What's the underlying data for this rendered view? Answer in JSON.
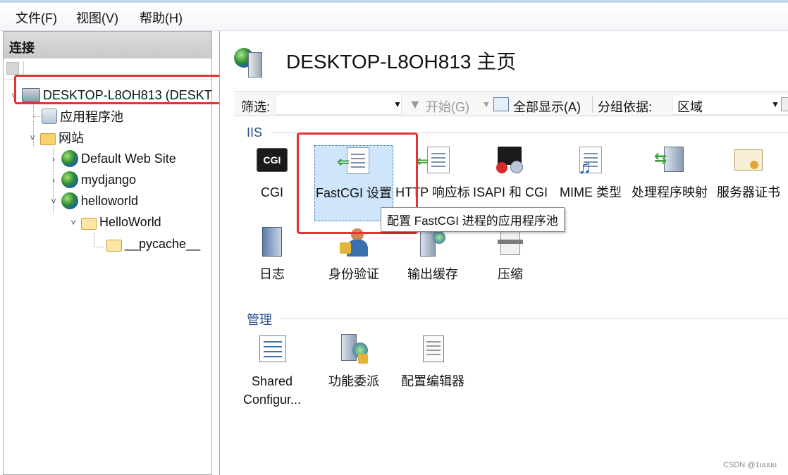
{
  "menu": [
    "文件(F)",
    "视图(V)",
    "帮助(H)"
  ],
  "connections": {
    "header": "连接",
    "tree": [
      {
        "label": "DESKTOP-L8OH813 (DESKT",
        "level": 0
      },
      {
        "label": "应用程序池",
        "level": 1
      },
      {
        "label": "网站",
        "level": 1
      },
      {
        "label": "Default Web Site",
        "level": 2
      },
      {
        "label": "mydjango",
        "level": 2
      },
      {
        "label": "helloworld",
        "level": 2
      },
      {
        "label": "HelloWorld",
        "level": 3
      },
      {
        "label": "__pycache__",
        "level": 4
      }
    ]
  },
  "main": {
    "title": "DESKTOP-L8OH813 主页",
    "filter": {
      "label": "筛选:",
      "value": "",
      "start_label": "开始(G)",
      "show_all_label": "全部显示(A)",
      "group_by_label": "分组依据:",
      "group_by_value": "区域"
    },
    "groups": [
      {
        "name": "IIS",
        "features": [
          {
            "label": "CGI",
            "icon": "cgi-icon"
          },
          {
            "label": "FastCGI 设置",
            "icon": "fastcgi-icon"
          },
          {
            "label": "HTTP 响应标",
            "icon": "http-response-headers-icon"
          },
          {
            "label": "ISAPI 和 CGI",
            "icon": "isapi-cgi-restrictions-icon"
          },
          {
            "label": "MIME 类型",
            "icon": "mime-types-icon"
          },
          {
            "label": "处理程序映射",
            "icon": "handler-mappings-icon"
          },
          {
            "label": "服务器证书",
            "icon": "server-certificates-icon"
          },
          {
            "label": "日志",
            "icon": "logging-icon"
          },
          {
            "label": "身份验证",
            "icon": "authentication-icon"
          },
          {
            "label": "输出缓存",
            "icon": "output-caching-icon"
          },
          {
            "label": "压缩",
            "icon": "compression-icon"
          }
        ]
      },
      {
        "name": "管理",
        "features": [
          {
            "label": "Shared Configur...",
            "icon": "shared-configuration-icon"
          },
          {
            "label": "功能委派",
            "icon": "feature-delegation-icon"
          },
          {
            "label": "配置编辑器",
            "icon": "configuration-editor-icon"
          }
        ]
      }
    ],
    "tooltip": "配置 FastCGI 进程的应用程序池"
  },
  "watermark": "CSDN @1uuuu",
  "colors": {
    "highlight_box": "#e53232",
    "selected_tile": "#cfe5fb",
    "group_label": "#2a4f8f"
  }
}
